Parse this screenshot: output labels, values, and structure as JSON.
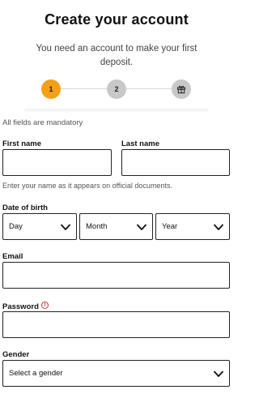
{
  "header": {
    "title": "Create your account",
    "subtitle": "You need an account to make your first deposit."
  },
  "stepper": {
    "steps": [
      {
        "label": "1",
        "state": "active"
      },
      {
        "label": "2",
        "state": "inactive"
      },
      {
        "label": "",
        "state": "inactive",
        "icon": "gift-icon"
      }
    ],
    "active_color": "#f4a012",
    "inactive_color": "#c8c8c8"
  },
  "form": {
    "mandatory_note": "All fields are mandatory",
    "first_name": {
      "label": "First name",
      "value": ""
    },
    "last_name": {
      "label": "Last name",
      "value": ""
    },
    "name_hint": "Enter your name as it appears on official documents.",
    "date_of_birth": {
      "label": "Date of birth",
      "day": "Day",
      "month": "Month",
      "year": "Year"
    },
    "email": {
      "label": "Email",
      "value": ""
    },
    "password": {
      "label": "Password",
      "info_icon": "info-icon",
      "info_symbol": "!",
      "value": ""
    },
    "gender": {
      "label": "Gender",
      "selected": "Select a gender"
    }
  }
}
